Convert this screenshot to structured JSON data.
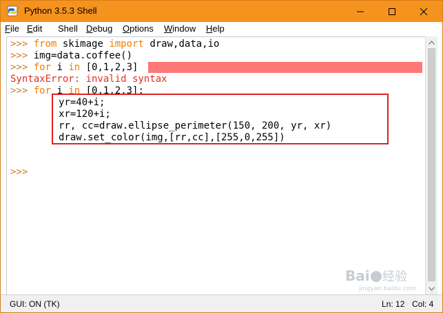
{
  "window": {
    "title": "Python 3.5.3 Shell",
    "accent_color": "#f5931e",
    "border_color": "#d47d1a"
  },
  "menu": {
    "items": [
      {
        "label": "File",
        "mnemonic": "F",
        "rest": "ile"
      },
      {
        "label": "Edit",
        "mnemonic": "E",
        "rest": "dit"
      },
      {
        "label": "Shell",
        "mnemonic": "S",
        "pre": "",
        "rest": "hell"
      },
      {
        "label": "Debug",
        "mnemonic": "D",
        "rest": "ebug"
      },
      {
        "label": "Options",
        "mnemonic": "O",
        "rest": "ptions"
      },
      {
        "label": "Window",
        "mnemonic": "W",
        "rest": "indow"
      },
      {
        "label": "Help",
        "mnemonic": "H",
        "rest": "elp"
      }
    ]
  },
  "editor": {
    "prompt": ">>>",
    "lines": {
      "l1_kw1": "from",
      "l1_mid": " skimage ",
      "l1_kw2": "import",
      "l1_rest": " draw,data,io",
      "l2": "img=data.coffee()",
      "l3_kw1": "for",
      "l3_mid": " i ",
      "l3_kw2": "in",
      "l3_rest": " [0,1,2,3]",
      "l4_err": "SyntaxError: invalid syntax",
      "l5_kw1": "for",
      "l5_mid": " i ",
      "l5_kw2": "in",
      "l5_rest": " [0,1,2,3]:",
      "l6": "yr=40+i;",
      "l7": "xr=120+i;",
      "l8": "rr, cc=draw.ellipse_perimeter(150, 200, yr, xr)",
      "l9": "draw.set_color(img,[rr,cc],[255,0,255])"
    },
    "colors": {
      "keyword": "#f07d00",
      "prompt": "#c77e2a",
      "error": "#e0301e",
      "error_highlight": "#ff7777",
      "annotation_box": "#e02020"
    }
  },
  "status": {
    "gui": "GUI: ON (TK)",
    "ln": "Ln: 12",
    "col": "Col: 4"
  },
  "watermark": {
    "text": "Baidu经验",
    "subtext": "jingyan.baidu.com"
  }
}
